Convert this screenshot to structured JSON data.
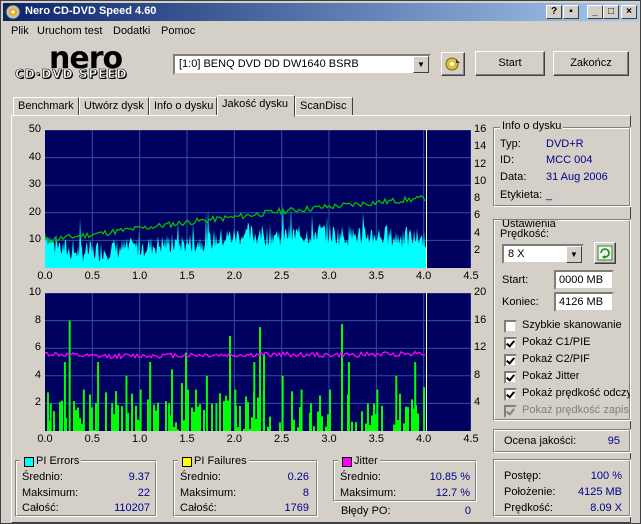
{
  "window": {
    "title": "Nero CD-DVD Speed 4.60"
  },
  "menu": [
    "Plik",
    "Uruchom test",
    "Dodatki",
    "Pomoc"
  ],
  "logo": {
    "main": "nero",
    "sub": "CD·DVD SPEED"
  },
  "drive": {
    "selected": "[1:0]  BENQ DVD DD DW1640 BSRB"
  },
  "buttons": {
    "start": "Start",
    "stop": "Zakończ"
  },
  "tabs": [
    "Benchmark",
    "Utwórz dysk",
    "Info o dysku",
    "Jakość dysku",
    "ScanDisc"
  ],
  "active_tab": 3,
  "disc_info": {
    "title": "Info o dysku",
    "rows": [
      {
        "label": "Typ:",
        "value": "DVD+R"
      },
      {
        "label": "ID:",
        "value": "MCC 004"
      },
      {
        "label": "Data:",
        "value": "31 Aug 2006"
      },
      {
        "label": "Etykieta:",
        "value": "_"
      }
    ]
  },
  "settings": {
    "title": "Ustawienia",
    "speed_label": "Prędkość:",
    "speed_value": "8 X",
    "start_label": "Start:",
    "start_value": "0000 MB",
    "end_label": "Koniec:",
    "end_value": "4126 MB",
    "checkboxes": [
      {
        "label": "Szybkie skanowanie",
        "checked": false,
        "disabled": false
      },
      {
        "label": "Pokaż C1/PIE",
        "checked": true,
        "disabled": false
      },
      {
        "label": "Pokaż C2/PIF",
        "checked": true,
        "disabled": false
      },
      {
        "label": "Pokaż Jitter",
        "checked": true,
        "disabled": false
      },
      {
        "label": "Pokaż prędkość odczytu",
        "checked": true,
        "disabled": false
      },
      {
        "label": "Pokaż prędkość zapisu",
        "checked": true,
        "disabled": true
      }
    ]
  },
  "quality": {
    "label": "Ocena jakości:",
    "value": "95"
  },
  "pi_errors": {
    "title": "PI Errors",
    "color": "#00ffff",
    "rows": [
      {
        "label": "Średnio:",
        "value": "9.37"
      },
      {
        "label": "Maksimum:",
        "value": "22"
      },
      {
        "label": "Całość:",
        "value": "110207"
      }
    ]
  },
  "pi_failures": {
    "title": "PI Failures",
    "color": "#ffff00",
    "rows": [
      {
        "label": "Średnio:",
        "value": "0.26"
      },
      {
        "label": "Maksimum:",
        "value": "8"
      },
      {
        "label": "Całość:",
        "value": "1769"
      }
    ]
  },
  "jitter": {
    "title": "Jitter",
    "color": "#ff00ff",
    "rows": [
      {
        "label": "Średnio:",
        "value": "10.85 %"
      },
      {
        "label": "Maksimum:",
        "value": "12.7 %"
      }
    ]
  },
  "po_failures": {
    "label": "Błędy PO:",
    "value": "0"
  },
  "progress": {
    "rows": [
      {
        "label": "Postęp:",
        "value": "100 %"
      },
      {
        "label": "Położenie:",
        "value": "4125 MB"
      },
      {
        "label": "Prędkość:",
        "value": "8.09 X"
      }
    ]
  },
  "chart_data": [
    {
      "type": "area",
      "title": "",
      "x_ticks": [
        "0.0",
        "0.5",
        "1.0",
        "1.5",
        "2.0",
        "2.5",
        "3.0",
        "3.5",
        "4.0",
        "4.5"
      ],
      "xlim": [
        0,
        4.5
      ],
      "y_left_ticks": [
        "10",
        "20",
        "30",
        "40",
        "50"
      ],
      "ylim_left": [
        0,
        50
      ],
      "y_right_ticks": [
        "2",
        "4",
        "6",
        "8",
        "10",
        "12",
        "14",
        "16"
      ],
      "ylim_right": [
        0,
        16
      ],
      "grid": true,
      "end_x": 4.03,
      "series": [
        {
          "name": "PI Errors",
          "color": "#00ffff",
          "axis": "left",
          "x": [
            0,
            0.1,
            0.3,
            0.5,
            0.7,
            0.9,
            1.1,
            1.3,
            1.5,
            1.7,
            1.9,
            2.1,
            2.3,
            2.5,
            2.7,
            2.9,
            3.1,
            3.3,
            3.5,
            3.7,
            3.9,
            4.03
          ],
          "values": [
            13,
            8,
            6,
            6,
            7,
            7,
            8,
            9,
            9,
            10,
            11,
            12,
            12,
            12,
            12,
            13,
            12,
            12,
            12,
            11,
            11,
            11
          ]
        },
        {
          "name": "Prędkość odczytu",
          "color": "#00c000",
          "axis": "right",
          "x": [
            0,
            0.5,
            1.0,
            1.5,
            2.0,
            2.5,
            3.0,
            3.5,
            4.03
          ],
          "values": [
            3.2,
            3.9,
            4.6,
            5.3,
            5.9,
            6.6,
            7.1,
            7.6,
            8.1
          ]
        }
      ]
    },
    {
      "type": "bar",
      "title": "",
      "x_ticks": [
        "0.0",
        "0.5",
        "1.0",
        "1.5",
        "2.0",
        "2.5",
        "3.0",
        "3.5",
        "4.0",
        "4.5"
      ],
      "xlim": [
        0,
        4.5
      ],
      "y_left_ticks": [
        "2",
        "4",
        "6",
        "8",
        "10"
      ],
      "ylim_left": [
        0,
        10
      ],
      "y_right_ticks": [
        "4",
        "8",
        "12",
        "16",
        "20"
      ],
      "ylim_right": [
        0,
        20
      ],
      "grid": true,
      "end_x": 4.03,
      "series": [
        {
          "name": "PI Failures",
          "color": "#00ff00",
          "axis": "left",
          "x": [
            0.05,
            0.2,
            0.25,
            0.4,
            0.55,
            0.7,
            0.85,
            1.0,
            1.1,
            1.3,
            1.5,
            1.7,
            1.8,
            2.0,
            2.2,
            2.3,
            2.5,
            2.7,
            2.8,
            3.0,
            3.2,
            3.4,
            3.5,
            3.7,
            3.9
          ],
          "values": [
            2,
            5,
            8,
            3,
            5,
            2,
            4,
            3,
            5,
            2,
            3,
            4,
            2,
            3,
            5,
            3,
            4,
            3,
            2,
            3,
            5,
            2,
            3,
            4,
            5
          ]
        },
        {
          "name": "Jitter",
          "color": "#ff00ff",
          "axis": "right",
          "x": [
            0,
            0.5,
            1.0,
            1.5,
            2.0,
            2.5,
            3.0,
            3.5,
            4.03
          ],
          "values": [
            11.2,
            10.8,
            10.9,
            11.0,
            11.0,
            11.1,
            11.0,
            11.1,
            11.3
          ]
        }
      ]
    }
  ]
}
